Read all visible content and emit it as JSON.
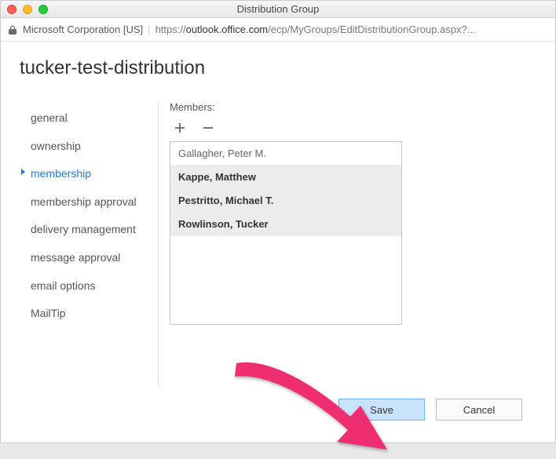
{
  "window": {
    "title": "Distribution Group"
  },
  "addressbar": {
    "org": "Microsoft Corporation [US]",
    "url_prefix": "https://",
    "url_host": "outlook.office.com",
    "url_path": "/ecp/MyGroups/EditDistributionGroup.aspx?..."
  },
  "page": {
    "title": "tucker-test-distribution"
  },
  "sidebar": {
    "items": [
      {
        "label": "general",
        "selected": false
      },
      {
        "label": "ownership",
        "selected": false
      },
      {
        "label": "membership",
        "selected": true
      },
      {
        "label": "membership approval",
        "selected": false
      },
      {
        "label": "delivery management",
        "selected": false
      },
      {
        "label": "message approval",
        "selected": false
      },
      {
        "label": "email options",
        "selected": false
      },
      {
        "label": "MailTip",
        "selected": false
      }
    ]
  },
  "panel": {
    "members_label": "Members:",
    "members": [
      "Gallagher, Peter M.",
      "Kappe, Matthew",
      "Pestritto, Michael T.",
      "Rowlinson, Tucker"
    ]
  },
  "footer": {
    "save": "Save",
    "cancel": "Cancel"
  },
  "colors": {
    "accent": "#2a7ad2",
    "arrow": "#ef2d72"
  }
}
